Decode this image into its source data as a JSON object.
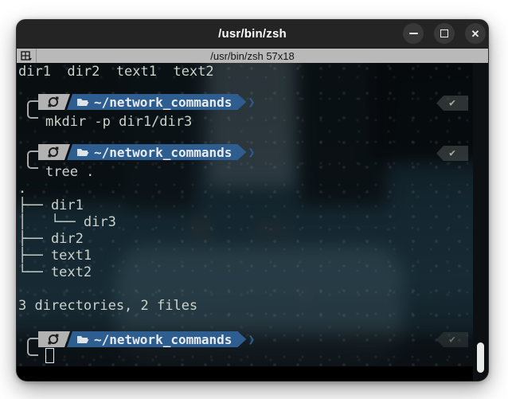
{
  "window": {
    "title": "/usr/bin/zsh",
    "minimize_glyph": "",
    "maximize_glyph": "",
    "close_glyph": "✕"
  },
  "tabbar": {
    "label": "/usr/bin/zsh 57x18"
  },
  "terminal": {
    "ls_output": "dir1  dir2  text1  text2",
    "prompt_path": "~/network_commands",
    "status_glyph": "✔",
    "chevron_glyph": "❯",
    "commands": {
      "0": "mkdir -p dir1/dir3",
      "1": "tree ."
    },
    "tree_lines": {
      "0": ".",
      "1": "├── dir1",
      "2": "│   └── dir3",
      "3": "├── dir2",
      "4": "├── text1",
      "5": "└── text2"
    },
    "summary": "3 directories, 2 files"
  },
  "colors": {
    "prompt_blue": "#2e5d90",
    "prompt_gray": "#b2b2b2",
    "titlebar_bg": "#242424",
    "tabbar_bg": "#b9b9b9",
    "terminal_text": "#ccd2cb"
  }
}
